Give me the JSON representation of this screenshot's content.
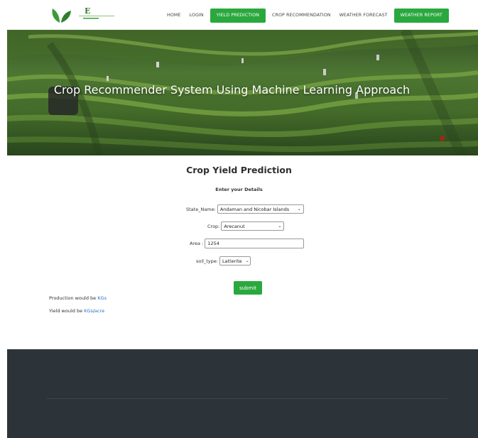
{
  "nav": {
    "links": [
      {
        "label": "HOME"
      },
      {
        "label": "LOGIN"
      },
      {
        "label": "YIELD PREDICTION"
      },
      {
        "label": "CROP RECOMMENDATION"
      },
      {
        "label": "WEATHER FORECAST"
      },
      {
        "label": "WEATHER REPORT"
      }
    ]
  },
  "hero": {
    "title": "Crop Recommender System Using Machine Learning Approach"
  },
  "form": {
    "title": "Crop Yield Prediction",
    "subtitle": "Enter your Details",
    "state_label": "State_Name:",
    "state_value": "Andaman and Nicobar Islands",
    "crop_label": "Crop:",
    "crop_value": "Arecanut",
    "area_label": "Area :",
    "area_value": "1254",
    "soil_label": "soil_type:",
    "soil_value": "Latterite",
    "submit_label": "submit"
  },
  "results": {
    "production_text": "Production would be",
    "production_unit": "KGs",
    "yield_text": "Yield would be",
    "yield_unit_a": "KGs",
    "yield_sep": "/",
    "yield_unit_b": "acre"
  },
  "colors": {
    "accent": "#2aa83e",
    "link": "#1e74c9",
    "footer": "#2c3339"
  }
}
